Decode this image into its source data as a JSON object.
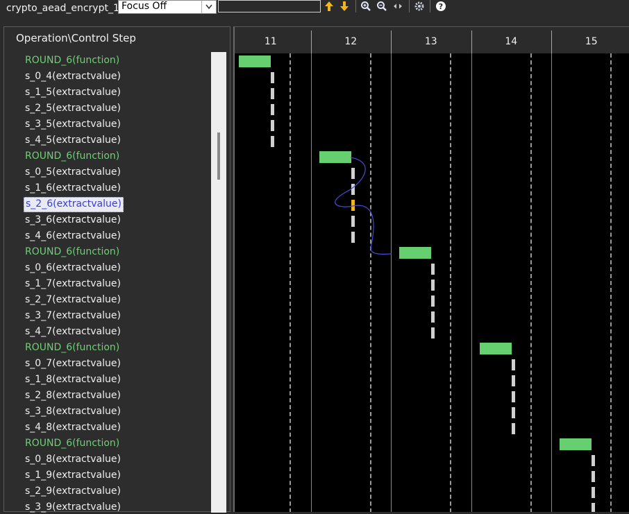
{
  "toolbar": {
    "title": "crypto_aead_encrypt_1",
    "focus_select": "Focus Off",
    "search_value": "",
    "icons": [
      "arrow-up-icon",
      "arrow-down-icon",
      "zoom-in-icon",
      "zoom-out-icon",
      "fit-width-icon",
      "settings-icon",
      "help-icon"
    ]
  },
  "left": {
    "header": "Operation\\Control Step",
    "rows": [
      {
        "label": "ROUND_6(function)",
        "kind": "function"
      },
      {
        "label": "s_0_4(extractvalue)",
        "kind": "op"
      },
      {
        "label": "s_1_5(extractvalue)",
        "kind": "op"
      },
      {
        "label": "s_2_5(extractvalue)",
        "kind": "op"
      },
      {
        "label": "s_3_5(extractvalue)",
        "kind": "op"
      },
      {
        "label": "s_4_5(extractvalue)",
        "kind": "op"
      },
      {
        "label": "ROUND_6(function)",
        "kind": "function"
      },
      {
        "label": "s_0_5(extractvalue)",
        "kind": "op"
      },
      {
        "label": "s_1_6(extractvalue)",
        "kind": "op"
      },
      {
        "label": "s_2_6(extractvalue)",
        "kind": "selected"
      },
      {
        "label": "s_3_6(extractvalue)",
        "kind": "op"
      },
      {
        "label": "s_4_6(extractvalue)",
        "kind": "op"
      },
      {
        "label": "ROUND_6(function)",
        "kind": "function"
      },
      {
        "label": "s_0_6(extractvalue)",
        "kind": "op"
      },
      {
        "label": "s_1_7(extractvalue)",
        "kind": "op"
      },
      {
        "label": "s_2_7(extractvalue)",
        "kind": "op"
      },
      {
        "label": "s_3_7(extractvalue)",
        "kind": "op"
      },
      {
        "label": "s_4_7(extractvalue)",
        "kind": "op"
      },
      {
        "label": "ROUND_6(function)",
        "kind": "function"
      },
      {
        "label": "s_0_7(extractvalue)",
        "kind": "op"
      },
      {
        "label": "s_1_8(extractvalue)",
        "kind": "op"
      },
      {
        "label": "s_2_8(extractvalue)",
        "kind": "op"
      },
      {
        "label": "s_3_8(extractvalue)",
        "kind": "op"
      },
      {
        "label": "s_4_8(extractvalue)",
        "kind": "op"
      },
      {
        "label": "ROUND_6(function)",
        "kind": "function"
      },
      {
        "label": "s_0_8(extractvalue)",
        "kind": "op"
      },
      {
        "label": "s_1_9(extractvalue)",
        "kind": "op"
      },
      {
        "label": "s_2_9(extractvalue)",
        "kind": "op"
      },
      {
        "label": "s_3_9(extractvalue)",
        "kind": "op"
      }
    ]
  },
  "steps": [
    "11",
    "12",
    "13",
    "14",
    "15"
  ],
  "colors": {
    "function": "#66d070",
    "operation": "#d0d0d0",
    "selected": "#f2b51d",
    "dependency": "#4a4ad8"
  }
}
